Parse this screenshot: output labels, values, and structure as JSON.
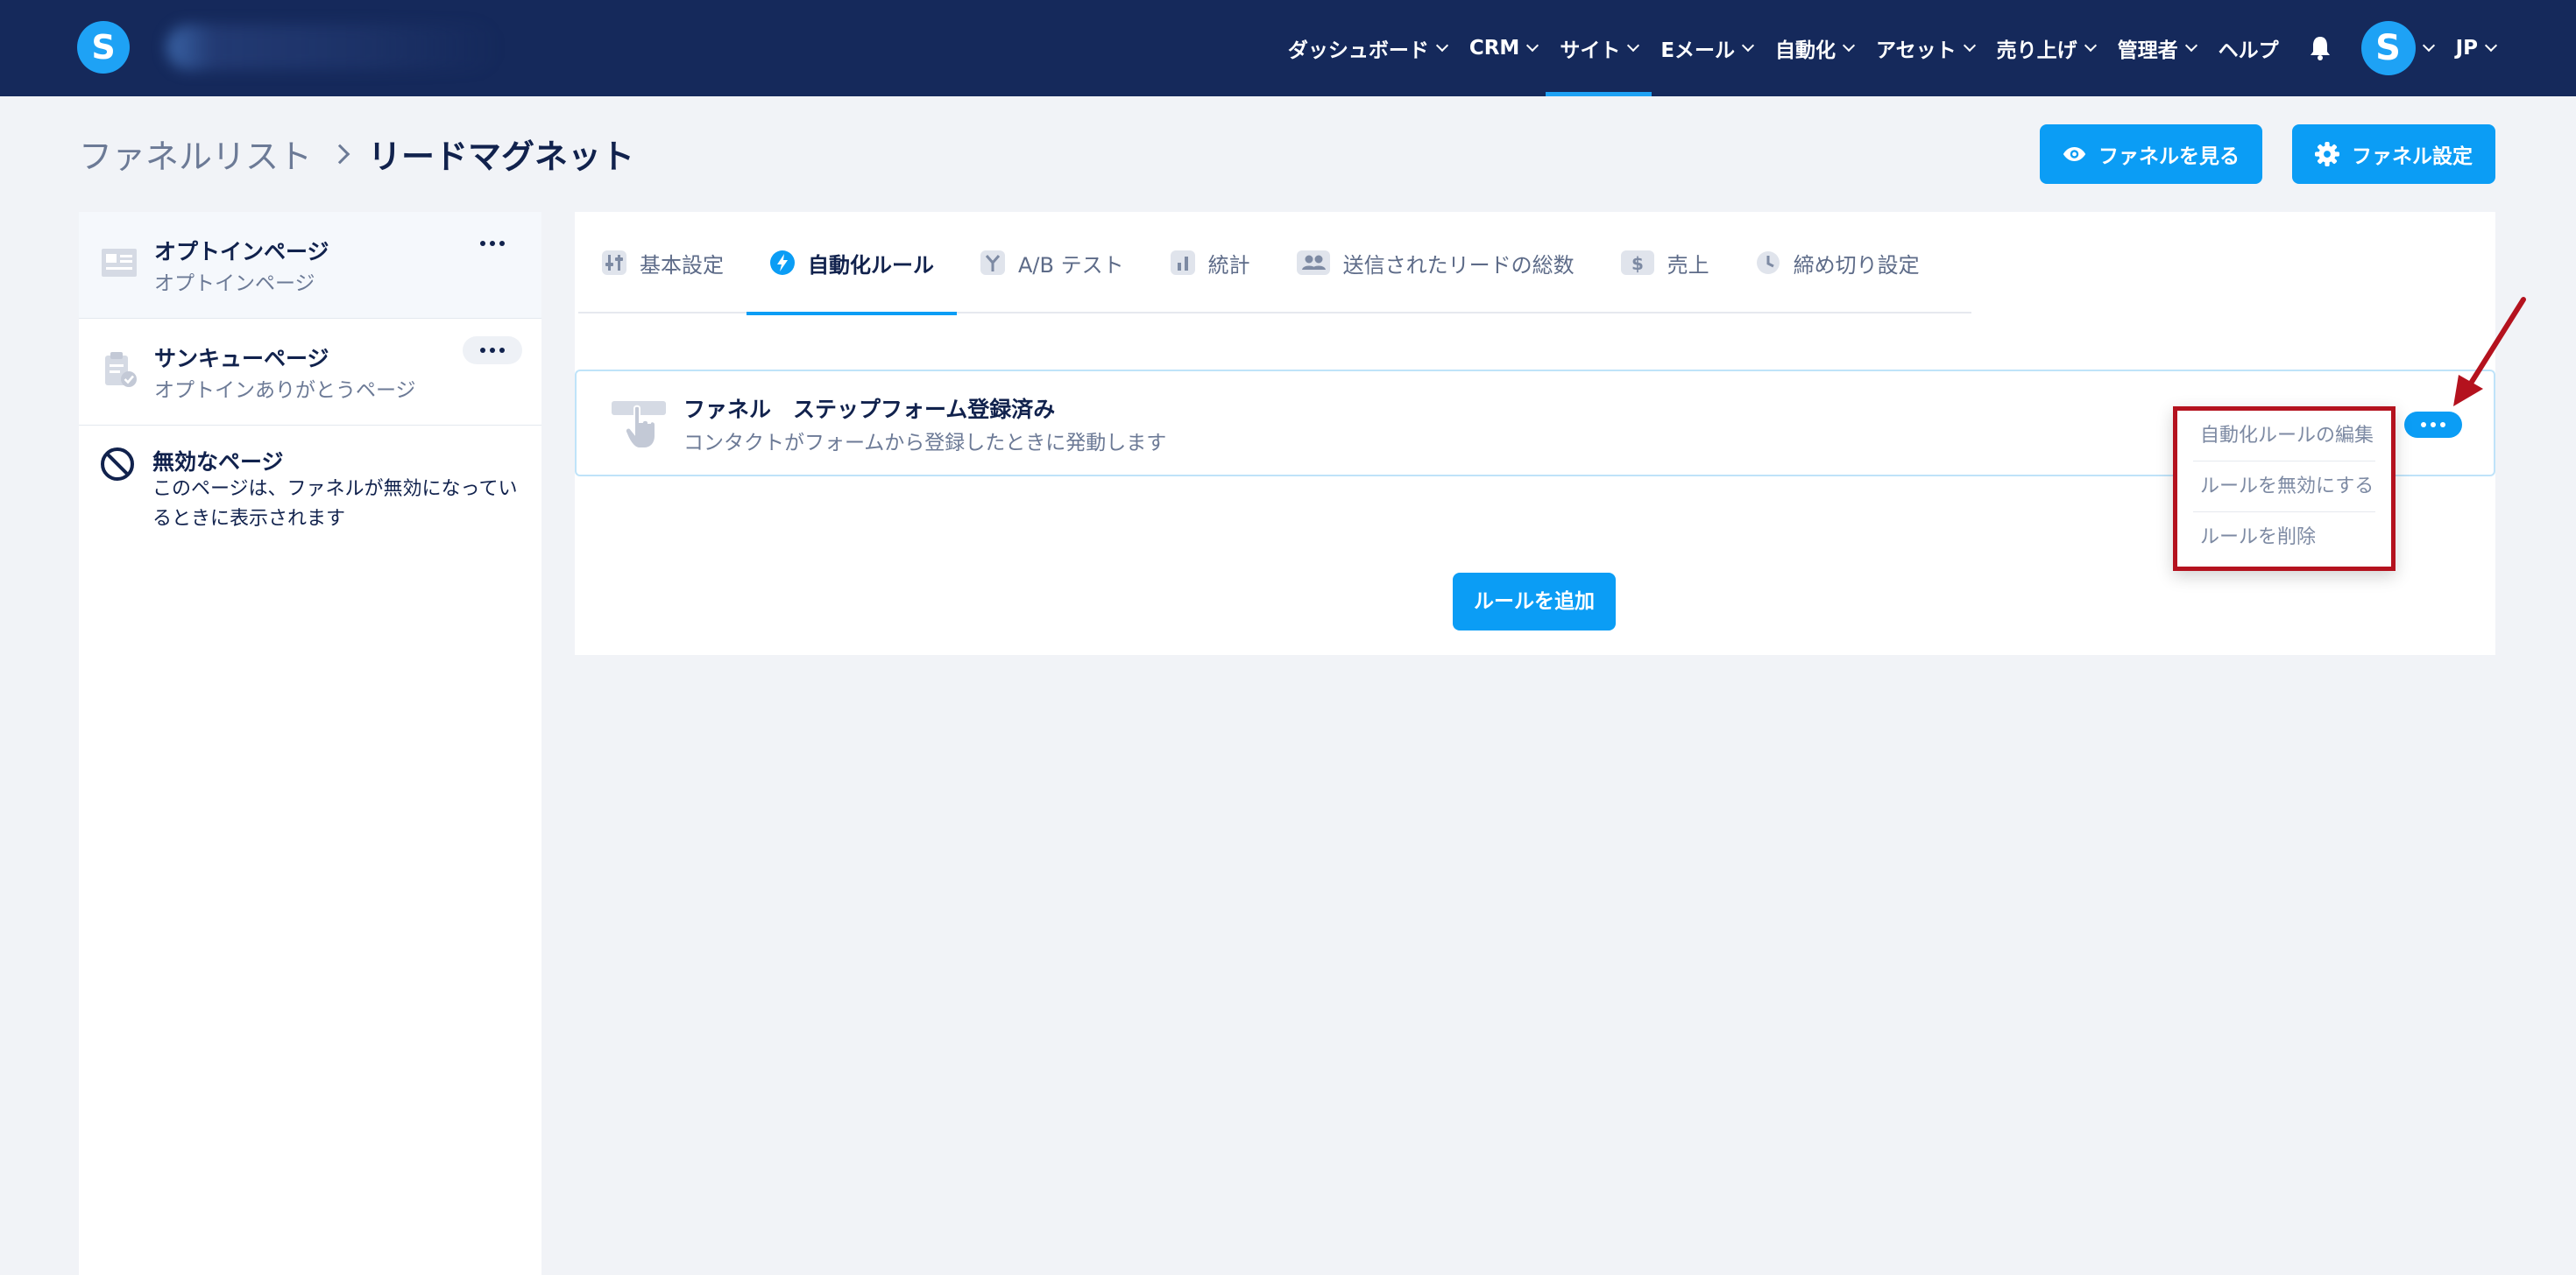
{
  "brand": {
    "logo_letter": "S"
  },
  "nav": {
    "items": [
      {
        "label": "ダッシュボード",
        "active": false
      },
      {
        "label": "CRM",
        "active": false
      },
      {
        "label": "サイト",
        "active": true
      },
      {
        "label": "Eメール",
        "active": false
      },
      {
        "label": "自動化",
        "active": false
      },
      {
        "label": "アセット",
        "active": false
      },
      {
        "label": "売り上げ",
        "active": false
      },
      {
        "label": "管理者",
        "active": false
      }
    ],
    "help_label": "ヘルプ",
    "avatar_letter": "S",
    "language": "JP"
  },
  "breadcrumb": {
    "parent": "ファネルリスト",
    "current": "リードマグネット"
  },
  "header_buttons": {
    "view_funnel": "ファネルを見る",
    "funnel_settings": "ファネル設定"
  },
  "sidebar": {
    "pages": [
      {
        "title": "オプトインページ",
        "subtitle": "オプトインページ"
      },
      {
        "title": "サンキューページ",
        "subtitle": "オプトインありがとうページ"
      }
    ],
    "disabled_page": {
      "title": "無効なページ",
      "description": "このページは、ファネルが無効になっているときに表示されます"
    }
  },
  "tabs": [
    {
      "label": "基本設定",
      "icon": "sliders-icon",
      "active": false
    },
    {
      "label": "自動化ルール",
      "icon": "lightning-icon",
      "active": true
    },
    {
      "label": "A/B テスト",
      "icon": "split-icon",
      "active": false
    },
    {
      "label": "統計",
      "icon": "bar-chart-icon",
      "active": false
    },
    {
      "label": "送信されたリードの総数",
      "icon": "users-icon",
      "active": false
    },
    {
      "label": "売上",
      "icon": "dollar-icon",
      "active": false
    },
    {
      "label": "締め切り設定",
      "icon": "clock-icon",
      "active": false
    }
  ],
  "rule": {
    "title": "ファネル　ステップフォーム登録済み",
    "description": "コンタクトがフォームから登録したときに発動します"
  },
  "rule_menu": {
    "items": [
      "自動化ルールの編集",
      "ルールを無効にする",
      "ルールを削除"
    ]
  },
  "add_rule_label": "ルールを追加",
  "colors": {
    "nav_bg": "#15295b",
    "accent": "#0b9df5",
    "highlight": "#b4121e"
  }
}
